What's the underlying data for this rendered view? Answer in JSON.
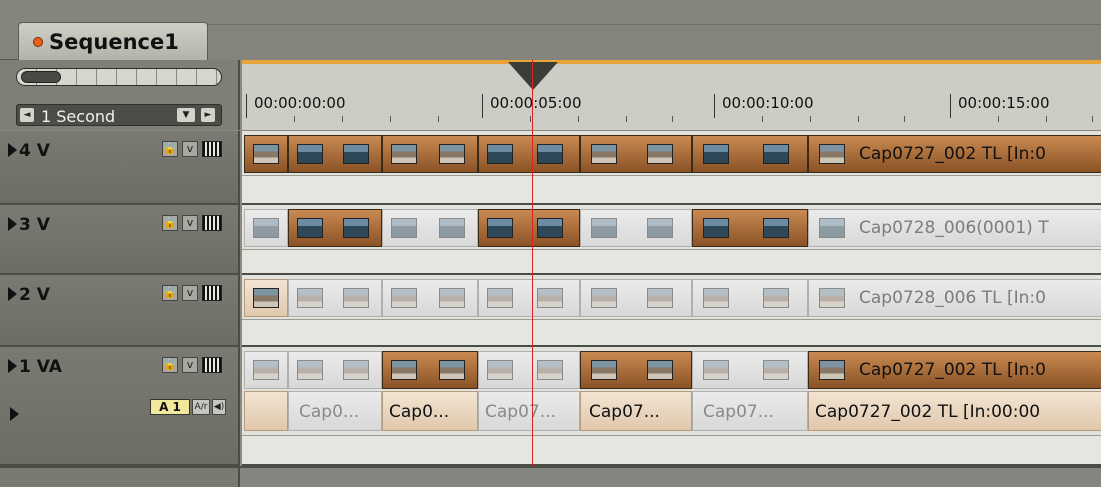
{
  "sequence_tab": {
    "label": "Sequence1"
  },
  "zoom_slider": {
    "value": 0.2
  },
  "unit_control": {
    "label": "1 Second",
    "left_arrow": "◄",
    "dropdown": "▼",
    "right_arrow": "►"
  },
  "ruler": {
    "timecodes": [
      "00:00:00:00",
      "00:00:05:00",
      "00:00:10:00",
      "00:00:15:00"
    ]
  },
  "tracks": [
    {
      "name": "4 V",
      "lock": "🔒",
      "vis": "v"
    },
    {
      "name": "3 V",
      "lock": "🔒",
      "vis": "v"
    },
    {
      "name": "2 V",
      "lock": "🔒",
      "vis": "v"
    },
    {
      "name": "1 VA",
      "lock": "🔒",
      "vis": "v",
      "audio_channel": "A 1",
      "audio_icon": "A/r",
      "speaker_icon": "◀)"
    }
  ],
  "clips": {
    "track4": "Cap0727_002  TL [In:0",
    "track3": "Cap0728_006(0001)  T",
    "track2": "Cap0728_006  TL [In:0",
    "track1": "Cap0727_002  TL [In:0"
  },
  "audio_clips": [
    "Cap0...",
    "Cap0...",
    "Cap07...",
    "Cap07...",
    "Cap07...",
    "Cap0727_002  TL [In:00:00"
  ]
}
